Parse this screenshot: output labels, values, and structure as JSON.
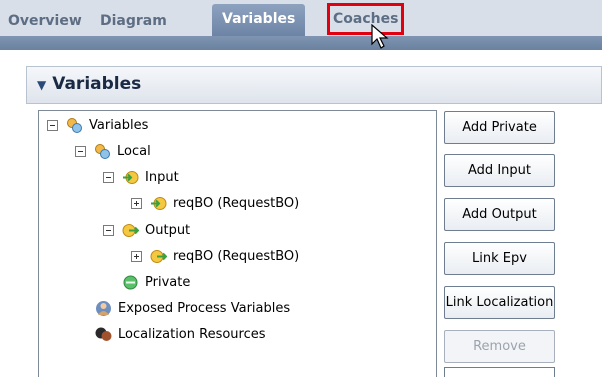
{
  "tabs": [
    {
      "label": "Overview",
      "active": false
    },
    {
      "label": "Diagram",
      "active": false
    },
    {
      "label": "Variables",
      "active": true
    },
    {
      "label": "Coaches",
      "active": false,
      "highlighted": true
    }
  ],
  "section": {
    "title": "Variables"
  },
  "tree": {
    "root": "Variables",
    "local": "Local",
    "input": "Input",
    "input_child": "reqBO (RequestBO)",
    "output": "Output",
    "output_child": "reqBO (RequestBO)",
    "private": "Private",
    "exposed": "Exposed Process Variables",
    "localization": "Localization Resources"
  },
  "buttons": {
    "add_private": "Add Private",
    "add_input": "Add Input",
    "add_output": "Add Output",
    "link_epv": "Link Epv",
    "link_localization": "Link Localization",
    "remove": "Remove"
  },
  "colors": {
    "highlight": "#e00010",
    "tab_active": "#7a90b0"
  }
}
